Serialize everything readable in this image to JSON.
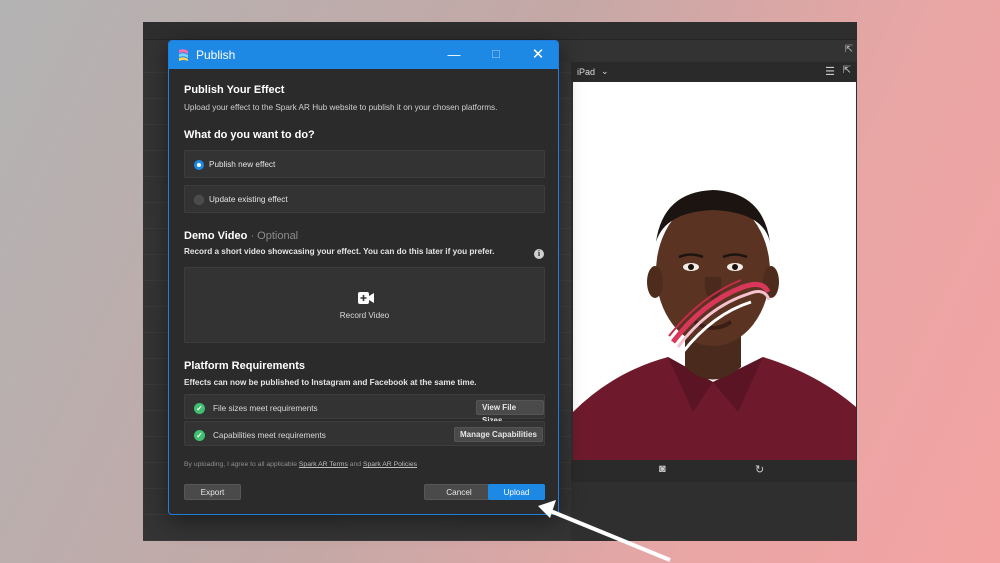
{
  "dialog": {
    "title": "Publish",
    "publish_heading": "Publish Your Effect",
    "publish_desc": "Upload your effect to the Spark AR Hub website to publish it on your chosen platforms.",
    "question": "What do you want to do?",
    "options": [
      {
        "label": "Publish new effect",
        "selected": true
      },
      {
        "label": "Update existing effect",
        "selected": false
      }
    ],
    "demo": {
      "heading": "Demo Video",
      "optional_label": "· Optional",
      "desc": "Record a short video showcasing your effect. You can do this later if you prefer.",
      "info_icon": "i",
      "record_label": "Record Video"
    },
    "platform": {
      "heading": "Platform Requirements",
      "desc": "Effects can now be published to Instagram and Facebook at the same time.",
      "rows": [
        {
          "label": "File sizes meet requirements",
          "button": "View File Sizes"
        },
        {
          "label": "Capabilities meet requirements",
          "button": "Manage Capabilities"
        }
      ]
    },
    "legal": {
      "prefix": "By uploading, I agree to all applicable",
      "terms": "Spark AR Terms",
      "and": "and",
      "policies": "Spark AR Policies"
    },
    "buttons": {
      "export": "Export",
      "cancel": "Cancel",
      "upload": "Upload"
    },
    "window_controls": {
      "minimize": "—",
      "maximize": "☐",
      "close": "✕"
    }
  },
  "simulator": {
    "device": "iPad",
    "device_chevron": "⌄",
    "menu_icon": "☰",
    "popout_icon": "⇱"
  },
  "colors": {
    "accent": "#1e88e5",
    "success": "#3fbf6f",
    "dialog_bg": "#2b2b2b"
  }
}
